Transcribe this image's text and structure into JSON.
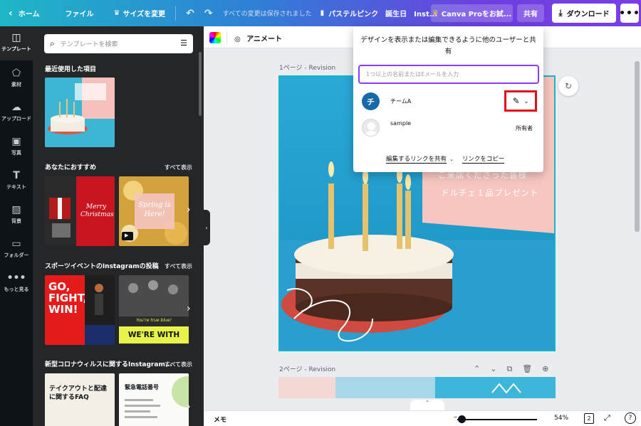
{
  "topbar": {
    "home_label": "ホーム",
    "file_label": "ファイル",
    "resize_label": "サイズを変更",
    "saved_status": "すべての変更は保存されました",
    "doc_title": "パステルピンク　誕生日　Inst...",
    "pro_label": "Canva Proをお試...",
    "share_label": "共有",
    "download_label": "ダウンロード",
    "more_label": "•••"
  },
  "leftnav": {
    "items": [
      {
        "label": "テンプレート",
        "icon": "layout-icon"
      },
      {
        "label": "素材",
        "icon": "shapes-icon"
      },
      {
        "label": "アップロード",
        "icon": "cloud-upload-icon"
      },
      {
        "label": "写真",
        "icon": "image-icon"
      },
      {
        "label": "テキスト",
        "icon": "text-icon"
      },
      {
        "label": "背景",
        "icon": "pattern-icon"
      },
      {
        "label": "フォルダー",
        "icon": "folder-icon"
      },
      {
        "label": "もっと見る",
        "icon": "more-icon"
      }
    ]
  },
  "panel": {
    "search_placeholder": "テンプレートを検索",
    "recent_title": "最近使用した項目",
    "recommend_title": "あなたにおすすめ",
    "recommend_link": "すべて表示",
    "sports_title": "スポーツイベントのInstagramの投稿",
    "sports_link": "すべて表示",
    "corona_title": "新型コロナウィルスに関するInstagram...",
    "corona_link": "すべて表示",
    "thumb_texts": {
      "christmas": "Merry Christmas",
      "spring": "Spring is Here!",
      "gofight": "GO, FIGHT, WIN!",
      "withyou_small": "You're true blue!",
      "withyou": "WE'RE WITH YOU!",
      "takeout": "テイクアウトと配達に関するFAQ",
      "emergency": "緊急電話番号"
    }
  },
  "toolbar": {
    "animate_label": "アニメート"
  },
  "canvas": {
    "page1_label": "1ページ - Revision",
    "page2_label": "2ページ - Revision",
    "design_text_line1": "ご来店くださった皆様",
    "design_text_line2": "ドルチェ１品プレゼント"
  },
  "share_popup": {
    "description": "デザインを表示または編集できるように他のユーザーと共有",
    "input_placeholder": "1つ以上の名前またはEメールを入力",
    "team_initial": "チ",
    "team_name": "チームA",
    "user_name": "sample",
    "user_role": "所有者",
    "share_link_label": "編集するリンクを共有",
    "copy_link_label": "リンクをコピー"
  },
  "bottombar": {
    "memo_label": "メモ",
    "zoom": "54%",
    "page_count": "2",
    "help_label": "?"
  },
  "colors": {
    "accent": "#8b3dff",
    "highlight": "#e30d1b",
    "selection": "#13b6c9"
  }
}
